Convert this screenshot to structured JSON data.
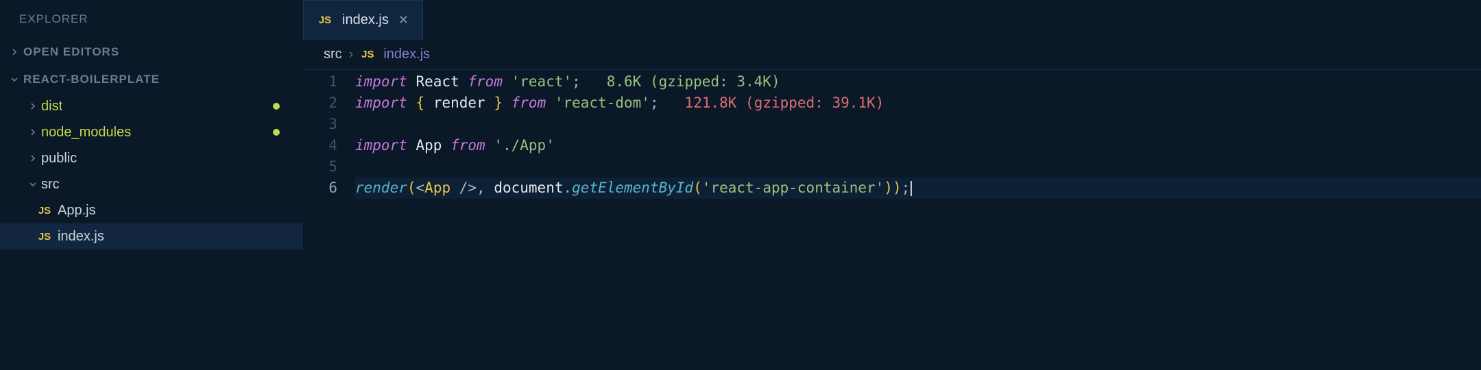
{
  "sidebar": {
    "explorer_label": "EXPLORER",
    "open_editors_label": "OPEN EDITORS",
    "project_name": "REACT-BOILERPLATE",
    "tree": [
      {
        "type": "folder",
        "label": "dist",
        "expanded": false,
        "modified": true,
        "green": true
      },
      {
        "type": "folder",
        "label": "node_modules",
        "expanded": false,
        "modified": true,
        "green": true
      },
      {
        "type": "folder",
        "label": "public",
        "expanded": false,
        "modified": false,
        "green": false
      },
      {
        "type": "folder",
        "label": "src",
        "expanded": true,
        "modified": false,
        "green": false
      },
      {
        "type": "file",
        "label": "App.js",
        "icon": "JS",
        "nested": true,
        "active": false
      },
      {
        "type": "file",
        "label": "index.js",
        "icon": "JS",
        "nested": true,
        "active": true
      }
    ]
  },
  "tabs": [
    {
      "icon": "JS",
      "name": "index.js",
      "active": true
    }
  ],
  "breadcrumb": {
    "parts": [
      {
        "text": "src",
        "type": "crumb"
      },
      {
        "icon": "JS",
        "text": "index.js",
        "type": "file"
      }
    ],
    "separator": "›"
  },
  "code": {
    "lines": [
      {
        "num": 1,
        "tokens": [
          {
            "t": "import",
            "c": "kw-import"
          },
          {
            "t": " ",
            "c": ""
          },
          {
            "t": "React",
            "c": "ident"
          },
          {
            "t": " ",
            "c": ""
          },
          {
            "t": "from",
            "c": "kw-from"
          },
          {
            "t": " ",
            "c": ""
          },
          {
            "t": "'react'",
            "c": "str"
          },
          {
            "t": ";",
            "c": "punc"
          },
          {
            "t": "   ",
            "c": ""
          },
          {
            "t": "8.6K (gzipped: 3.4K)",
            "c": "cost-green"
          }
        ]
      },
      {
        "num": 2,
        "tokens": [
          {
            "t": "import",
            "c": "kw-import"
          },
          {
            "t": " ",
            "c": ""
          },
          {
            "t": "{",
            "c": "brace"
          },
          {
            "t": " render ",
            "c": "ident"
          },
          {
            "t": "}",
            "c": "brace"
          },
          {
            "t": " ",
            "c": ""
          },
          {
            "t": "from",
            "c": "kw-from"
          },
          {
            "t": " ",
            "c": ""
          },
          {
            "t": "'react-dom'",
            "c": "str"
          },
          {
            "t": ";",
            "c": "punc"
          },
          {
            "t": "   ",
            "c": ""
          },
          {
            "t": "121.8K (gzipped: 39.1K)",
            "c": "cost-red"
          }
        ]
      },
      {
        "num": 3,
        "tokens": []
      },
      {
        "num": 4,
        "tokens": [
          {
            "t": "import",
            "c": "kw-import"
          },
          {
            "t": " ",
            "c": ""
          },
          {
            "t": "App",
            "c": "ident"
          },
          {
            "t": " ",
            "c": ""
          },
          {
            "t": "from",
            "c": "kw-from"
          },
          {
            "t": " ",
            "c": ""
          },
          {
            "t": "'./App'",
            "c": "str"
          }
        ]
      },
      {
        "num": 5,
        "tokens": []
      },
      {
        "num": 6,
        "active": true,
        "tokens": [
          {
            "t": "render",
            "c": "fn-call"
          },
          {
            "t": "(",
            "c": "brace"
          },
          {
            "t": "<",
            "c": "punc"
          },
          {
            "t": "App",
            "c": "tag"
          },
          {
            "t": " />",
            "c": "punc"
          },
          {
            "t": ", ",
            "c": "punc"
          },
          {
            "t": "document",
            "c": "obj"
          },
          {
            "t": ".",
            "c": "punc"
          },
          {
            "t": "getElementById",
            "c": "method"
          },
          {
            "t": "(",
            "c": "brace"
          },
          {
            "t": "'react-app-container'",
            "c": "str"
          },
          {
            "t": ")",
            "c": "brace"
          },
          {
            "t": ")",
            "c": "brace"
          },
          {
            "t": ";",
            "c": "punc"
          }
        ],
        "cursor": true
      }
    ]
  }
}
